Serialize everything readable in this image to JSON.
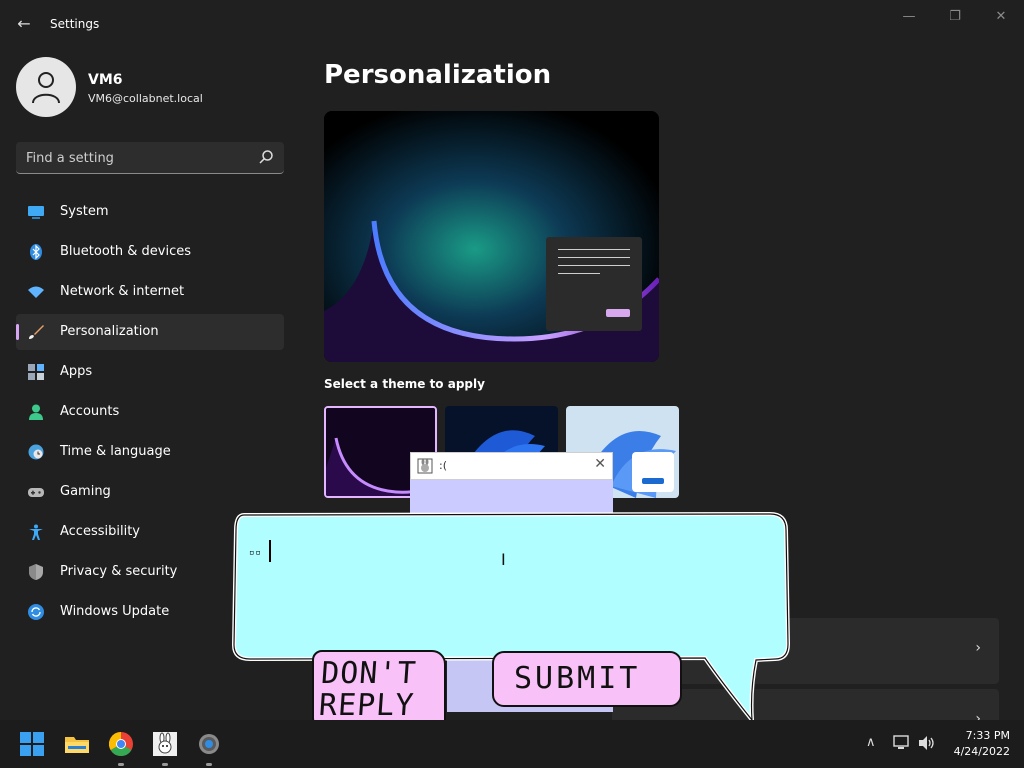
{
  "window": {
    "title": "Settings",
    "back_icon": "back-arrow-icon",
    "controls": {
      "minimize": "—",
      "maximize": "❐",
      "close": "✕"
    }
  },
  "profile": {
    "name": "VM6",
    "email": "VM6@collabnet.local"
  },
  "search": {
    "placeholder": "Find a setting"
  },
  "nav": {
    "items": [
      {
        "label": "System",
        "icon": "system-monitor-icon",
        "color": "#3fa9f5"
      },
      {
        "label": "Bluetooth & devices",
        "icon": "bluetooth-icon",
        "color": "#2f8de4"
      },
      {
        "label": "Network & internet",
        "icon": "wifi-icon",
        "color": "#5fb3ff"
      },
      {
        "label": "Personalization",
        "icon": "paint-brush-icon",
        "color": "#e8a06a",
        "active": true
      },
      {
        "label": "Apps",
        "icon": "apps-icon",
        "color": "#9aa7b8"
      },
      {
        "label": "Accounts",
        "icon": "person-icon",
        "color": "#3ec98c"
      },
      {
        "label": "Time & language",
        "icon": "globe-clock-icon",
        "color": "#4aa3df"
      },
      {
        "label": "Gaming",
        "icon": "gamepad-icon",
        "color": "#b8b8b8"
      },
      {
        "label": "Accessibility",
        "icon": "accessibility-icon",
        "color": "#3fa9f5"
      },
      {
        "label": "Privacy & security",
        "icon": "shield-icon",
        "color": "#a8a8a8"
      },
      {
        "label": "Windows Update",
        "icon": "update-icon",
        "color": "#2f8de4"
      }
    ]
  },
  "main": {
    "title": "Personalization",
    "theme_section_label": "Select a theme to apply"
  },
  "popup": {
    "title": ":("
  },
  "bubble": {
    "text_glyphs": "▫▫",
    "dont_reply_label": "DON'T REPLY",
    "submit_label": "SUBMIT"
  },
  "taskbar": {
    "icons": [
      "windows-start-icon",
      "file-explorer-icon",
      "chrome-icon",
      "bunny-app-icon",
      "settings-gear-icon"
    ],
    "time": "7:33 PM",
    "date": "4/24/2022"
  },
  "colors": {
    "accent": "#d7a6f2",
    "bubble_fill": "#b0feff",
    "button_fill": "#f8c2f8",
    "popup_fill": "#cbcbff"
  }
}
